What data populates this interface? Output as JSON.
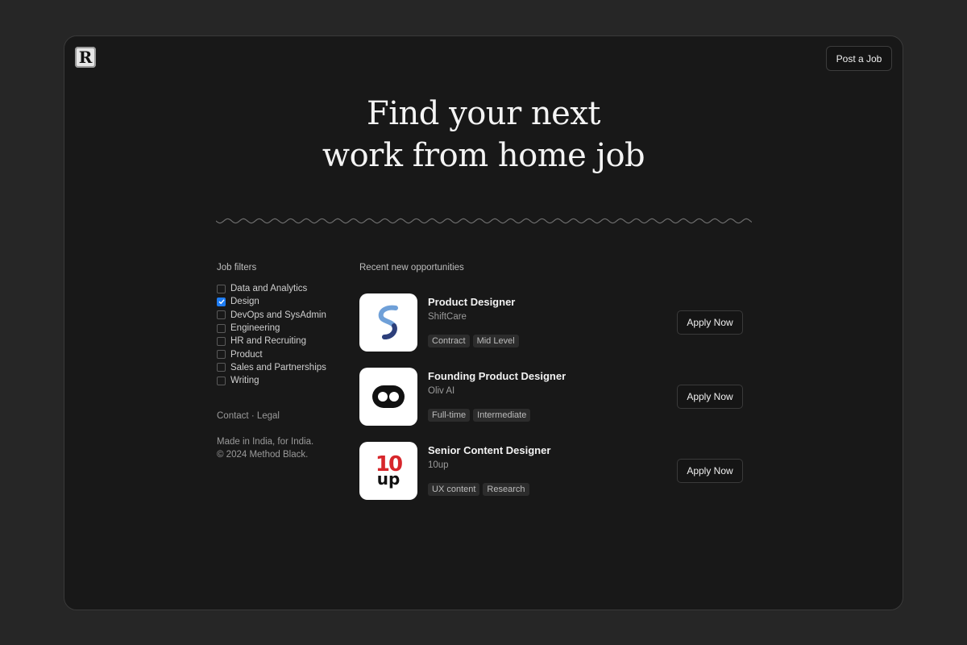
{
  "header": {
    "logo_letter": "R",
    "post_job_label": "Post a Job"
  },
  "hero": {
    "line1": "Find your next",
    "line2": "work from home job"
  },
  "filters": {
    "title": "Job filters",
    "items": [
      {
        "label": "Data and Analytics",
        "checked": false
      },
      {
        "label": "Design",
        "checked": true
      },
      {
        "label": "DevOps and SysAdmin",
        "checked": false
      },
      {
        "label": "Engineering",
        "checked": false
      },
      {
        "label": "HR and Recruiting",
        "checked": false
      },
      {
        "label": "Product",
        "checked": false
      },
      {
        "label": "Sales and Partnerships",
        "checked": false
      },
      {
        "label": "Writing",
        "checked": false
      }
    ],
    "footer_links": "Contact · Legal",
    "footer_line1": "Made in India, for India.",
    "footer_line2": "© 2024 Method Black."
  },
  "jobs": {
    "title": "Recent new opportunities",
    "apply_label": "Apply Now",
    "items": [
      {
        "title": "Product Designer",
        "company": "ShiftCare",
        "tags": [
          "Contract",
          "Mid Level"
        ],
        "logo": "shiftcare-logo"
      },
      {
        "title": "Founding Product Designer",
        "company": "Oliv AI",
        "tags": [
          "Full-time",
          "Intermediate"
        ],
        "logo": "oliv-logo"
      },
      {
        "title": "Senior Content Designer",
        "company": "10up",
        "tags": [
          "UX content",
          "Research"
        ],
        "logo": "tenup-logo",
        "logo_text_top": "10",
        "logo_text_bottom": "up"
      }
    ]
  },
  "colors": {
    "background": "#262626",
    "panel": "#181818",
    "accent": "#1e7cf2",
    "tenup_red": "#d7262b"
  }
}
